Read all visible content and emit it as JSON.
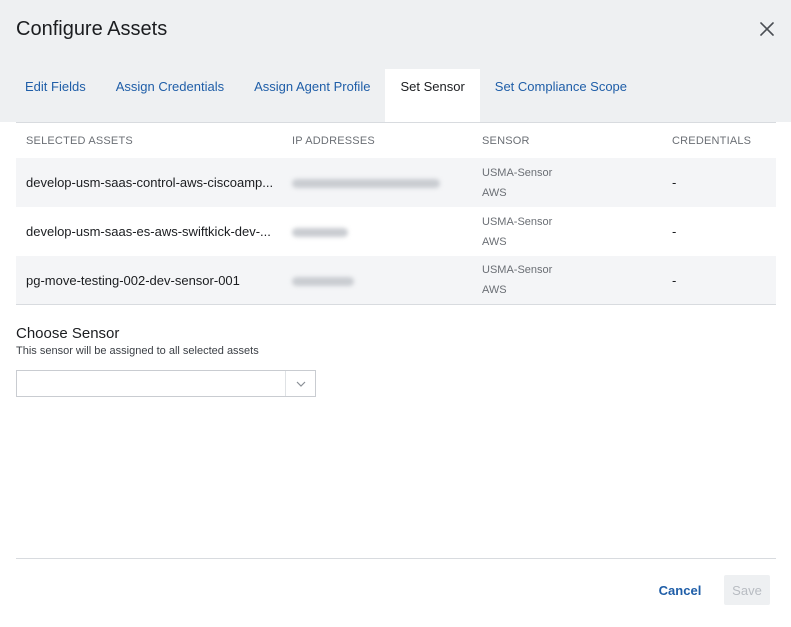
{
  "dialog": {
    "title": "Configure Assets",
    "close_icon": "close-icon"
  },
  "tabs": [
    {
      "label": "Edit Fields",
      "active": false
    },
    {
      "label": "Assign Credentials",
      "active": false
    },
    {
      "label": "Assign Agent Profile",
      "active": false
    },
    {
      "label": "Set Sensor",
      "active": true
    },
    {
      "label": "Set Compliance Scope",
      "active": false
    }
  ],
  "table": {
    "headers": [
      "SELECTED ASSETS",
      "IP ADDRESSES",
      "SENSOR",
      "CREDENTIALS"
    ],
    "rows": [
      {
        "asset": "develop-usm-saas-control-aws-ciscoamp...",
        "sensor_line1": "USMA-Sensor",
        "sensor_line2": "AWS",
        "credentials": "-"
      },
      {
        "asset": "develop-usm-saas-es-aws-swiftkick-dev-...",
        "sensor_line1": "USMA-Sensor",
        "sensor_line2": "AWS",
        "credentials": "-"
      },
      {
        "asset": "pg-move-testing-002-dev-sensor-001",
        "sensor_line1": "USMA-Sensor",
        "sensor_line2": "AWS",
        "credentials": "-"
      }
    ]
  },
  "choose_sensor": {
    "title": "Choose Sensor",
    "description": "This sensor will be assigned to all selected assets",
    "selected_value": "",
    "dropdown_icon": "chevron-down-icon"
  },
  "footer": {
    "cancel_label": "Cancel",
    "save_label": "Save"
  },
  "colors": {
    "accent": "#1f5ea8",
    "header_bg": "#eef0f2",
    "row_alt": "#f4f5f7"
  }
}
